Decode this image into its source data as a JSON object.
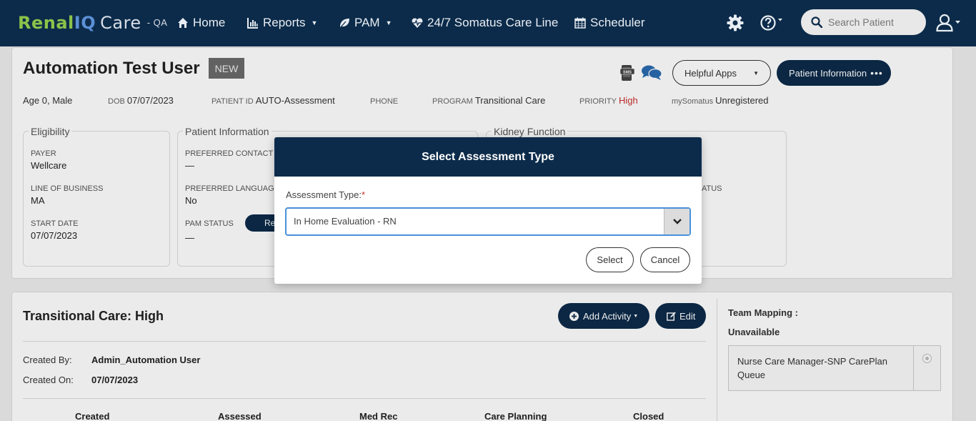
{
  "brand": {
    "part1": "Renal",
    "part2": "IQ",
    "part3": "Care",
    "env": "- QA"
  },
  "nav": {
    "home": "Home",
    "reports": "Reports",
    "pam": "PAM",
    "careline": "24/7 Somatus Care Line",
    "scheduler": "Scheduler",
    "search_placeholder": "Search Patient"
  },
  "patient": {
    "name": "Automation Test User",
    "badge": "NEW",
    "helpful_apps": "Helpful Apps",
    "patient_info_btn": "Patient Information",
    "age_sex": "Age 0, Male",
    "dob_label": "DOB",
    "dob": "07/07/2023",
    "id_label": "PATIENT ID",
    "id": "AUTO-Assessment",
    "phone_label": "PHONE",
    "program_label": "PROGRAM",
    "program": "Transitional Care",
    "priority_label": "PRIORITY",
    "priority": "High",
    "mysomatus_label": "mySomatus",
    "mysomatus": "Unregistered"
  },
  "eligibility": {
    "title": "Eligibility",
    "payer_label": "PAYER",
    "payer": "Wellcare",
    "lob_label": "LINE OF BUSINESS",
    "lob": "MA",
    "start_label": "START DATE",
    "start": "07/07/2023"
  },
  "patient_information": {
    "title": "Patient Information",
    "contact_label": "PREFERRED CONTACT S",
    "contact": "—",
    "language_label": "PREFERRED LANGUAGE",
    "language": "No",
    "pam_label": "PAM STATUS",
    "pam": "—",
    "pam_pill": "Re"
  },
  "kidney": {
    "title": "Kidney Function",
    "status_label": "ATUS"
  },
  "care_section": {
    "title": "Transitional Care: High",
    "add_activity": "Add Activity",
    "edit": "Edit",
    "created_by_label": "Created By:",
    "created_by": "Admin_Automation User",
    "created_on_label": "Created On:",
    "created_on": "07/07/2023",
    "columns": [
      "Created",
      "Assessed",
      "Med Rec",
      "Care Planning",
      "Closed"
    ]
  },
  "team_mapping": {
    "title": "Team Mapping :",
    "status": "Unavailable",
    "queue": "Nurse Care Manager-SNP CarePlan Queue"
  },
  "modal": {
    "title": "Select Assessment Type",
    "label": "Assessment Type:",
    "required": "*",
    "selected": "In Home Evaluation - RN",
    "select_btn": "Select",
    "cancel_btn": "Cancel"
  },
  "colors": {
    "navy": "#0c2b4a",
    "brand_green": "#8bc34a",
    "brand_blue": "#5b8fd6",
    "priority_red": "#c9302c"
  }
}
